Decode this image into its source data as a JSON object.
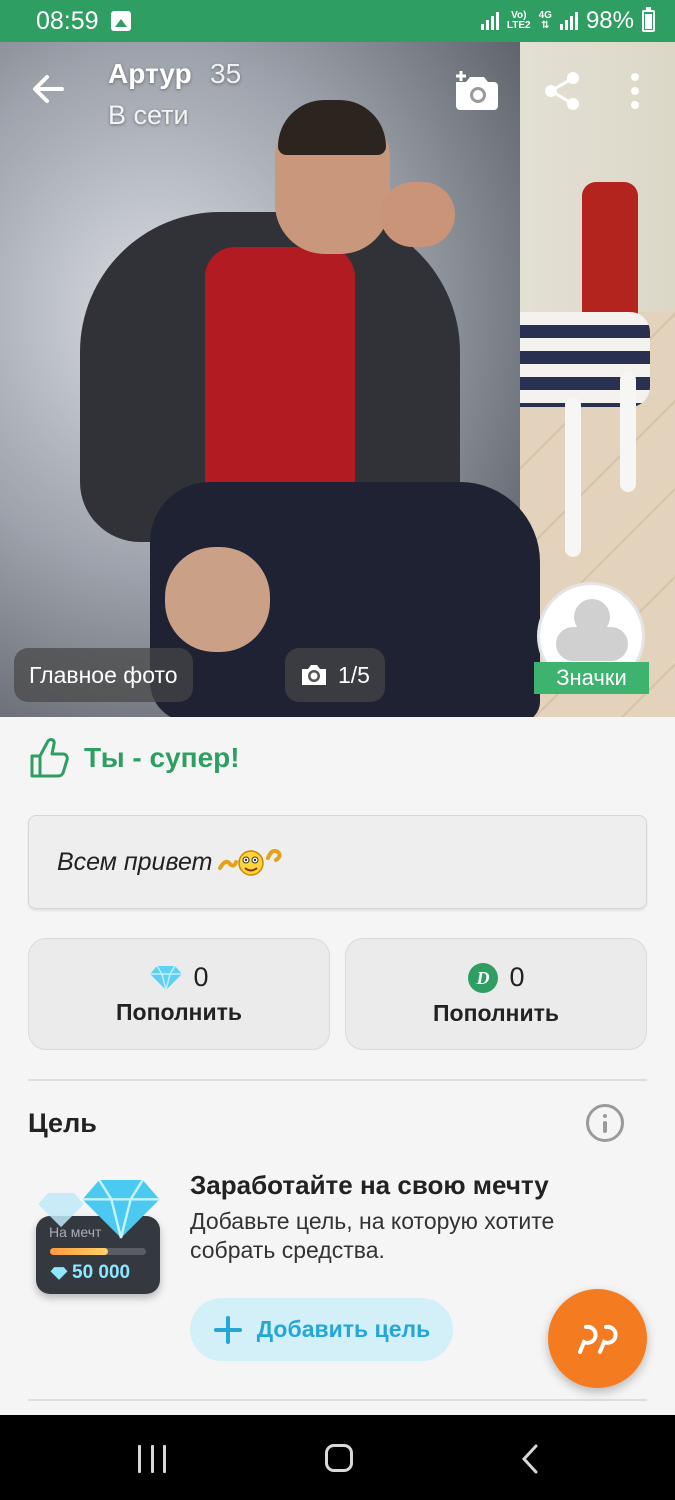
{
  "status_bar": {
    "time": "08:59",
    "network_top": "Vo)",
    "network_bottom": "LTE2",
    "network_type": "4G",
    "battery": "98%"
  },
  "profile": {
    "name": "Артур",
    "age": "35",
    "status": "В сети",
    "main_photo_label": "Главное фото",
    "photo_counter": "1/5",
    "badges_label": "Значки"
  },
  "compliment": {
    "text": "Ты - супер!",
    "color": "#2f9e63"
  },
  "about": {
    "text": "Всем привет"
  },
  "wallets": [
    {
      "icon": "diamond-icon",
      "value": "0",
      "action": "Пополнить"
    },
    {
      "icon": "d-coin-icon",
      "value": "0",
      "action": "Пополнить"
    }
  ],
  "goal": {
    "title": "Цель",
    "card_label": "На мечт",
    "card_amount": "50 000",
    "card_progress": 0.6,
    "headline": "Заработайте на свою мечту",
    "description": "Добавьте цель, на которую хотите собрать средства.",
    "add_button": "Добавить цель"
  },
  "colors": {
    "status_bar": "#2e9e63",
    "accent_green": "#3db36f",
    "fab": "#f47b20",
    "add_goal_text": "#24a6d6"
  }
}
